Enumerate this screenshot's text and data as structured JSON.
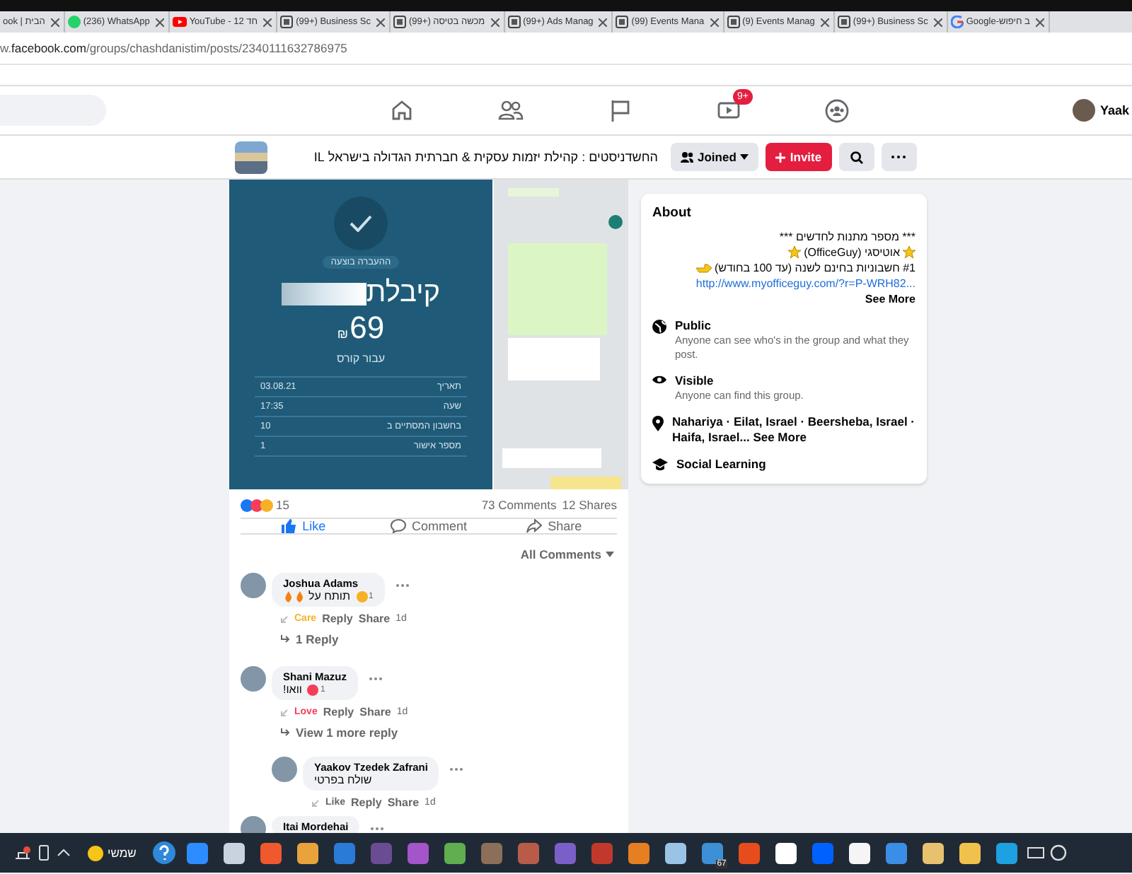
{
  "browser": {
    "tabs": [
      {
        "kind": "none",
        "title": "ook | הבית"
      },
      {
        "kind": "whatsapp",
        "title": "(236) WhatsApp"
      },
      {
        "kind": "youtube",
        "title": "YouTube - 12 חד"
      },
      {
        "kind": "facebook",
        "title": "(99+) Business Sc"
      },
      {
        "kind": "facebook",
        "title": "(99+) מכשה בטיסה"
      },
      {
        "kind": "facebook",
        "title": "(99+) Ads Manag"
      },
      {
        "kind": "facebook",
        "title": "(99) Events Mana"
      },
      {
        "kind": "facebook",
        "title": "(9) Events Manag"
      },
      {
        "kind": "facebook",
        "title": "(99+) Business Sc"
      },
      {
        "kind": "google",
        "title": "Google-ב חיפוש"
      }
    ],
    "url": {
      "prefix": "w.",
      "domain": "facebook.com",
      "path": "/groups/chashdanistim/posts/2340111632786975"
    }
  },
  "topbar": {
    "nav": [
      {
        "kind": "home"
      },
      {
        "kind": "friends"
      },
      {
        "kind": "pages"
      },
      {
        "kind": "watch",
        "badge": "9+"
      },
      {
        "kind": "groups"
      }
    ],
    "profile": "Yaak"
  },
  "group": {
    "title": "החשדניסטים : קהילת יזמות עסקית & חברתית הגדולה בישראל IL",
    "joined": "Joined",
    "invite": "Invite"
  },
  "post": {
    "receipt": {
      "status": "ההעברה בוצעה",
      "heading": "קיבלת",
      "amount": "69",
      "currency": "₪",
      "purpose": "עבור קורס",
      "rows": [
        {
          "label": "תאריך",
          "value": "03.08.21"
        },
        {
          "label": "שעה",
          "value": "17:35"
        },
        {
          "label": "בחשבון המסתיים ב",
          "value": "10"
        },
        {
          "label": "מספר אישור",
          "value": "1"
        }
      ]
    },
    "reactions": "15",
    "comments": "73 Comments",
    "shares": "12 Shares",
    "actions": [
      {
        "kind": "like",
        "label": "Like",
        "color": "#1877f2"
      },
      {
        "kind": "comment",
        "label": "Comment",
        "color": "#65676b"
      },
      {
        "kind": "share",
        "label": "Share",
        "color": "#65676b"
      }
    ],
    "sort": "All Comments",
    "thread": [
      {
        "author": "Joshua Adams",
        "text": "תותח על",
        "kind": "fire",
        "reaction_count": "1",
        "action": {
          "label": "Care",
          "color": "#f7b125"
        },
        "links": [
          "Reply",
          "Share"
        ],
        "time": "1d",
        "more": "1 Reply"
      },
      {
        "author": "Shani Mazuz",
        "text": "וואו!",
        "kind": "plain",
        "reaction_count": "1",
        "action": {
          "label": "Love",
          "color": "#f33e58"
        },
        "links": [
          "Reply",
          "Share"
        ],
        "time": "1d",
        "more": "View 1 more reply",
        "children": [
          {
            "author": "Yaakov Tzedek Zafrani",
            "text": "שולח בפרטי",
            "kind": "plain",
            "action": {
              "label": "Like",
              "color": "#65676b"
            },
            "links": [
              "Reply",
              "Share"
            ],
            "time": "1d"
          }
        ]
      },
      {
        "author": "Itai Mordehai"
      }
    ]
  },
  "about": {
    "title": "About",
    "description": [
      {
        "kind": "plain",
        "text": "*** מספר מתנות לחדשים ***"
      },
      {
        "kind": "starred",
        "text": "אוטיסגי (OfficeGuy)"
      },
      {
        "kind": "pointer",
        "text": "#1 חשבוניות בחינם לשנה (עד 100 בחודש)"
      }
    ],
    "link": "http://www.myofficeguy.com/?r=P-WRH82...",
    "see_more": "See More",
    "items": [
      {
        "kind": "globe",
        "title": "Public",
        "text": "Anyone can see who's in the group and what they post."
      },
      {
        "kind": "eye",
        "title": "Visible",
        "text": "Anyone can find this group."
      },
      {
        "kind": "pin",
        "title": "Nahariya · Eilat, Israel · Beersheba, Israel · Haifa, Israel...",
        "link": "See More"
      },
      {
        "kind": "cap",
        "title": "Social Learning"
      }
    ]
  },
  "taskbar": {
    "weather": "שמשי",
    "apps": [
      {
        "color": "#2d8cff"
      },
      {
        "color": "#c9d3e0"
      },
      {
        "color": "#f0582e"
      },
      {
        "color": "#e8a33d"
      },
      {
        "color": "#2a7bd8"
      },
      {
        "color": "#6a4c93"
      },
      {
        "color": "#a355c9"
      },
      {
        "color": "#5fae4f"
      },
      {
        "color": "#8b6f5a"
      },
      {
        "color": "#b85c4a"
      },
      {
        "color": "#7a5fc9"
      },
      {
        "color": "#c0392b"
      },
      {
        "color": "#e67e22"
      },
      {
        "color": "#9bc3e6"
      },
      {
        "color": "#3d8fd6",
        "badge": "67"
      },
      {
        "color": "#e74c1c"
      },
      {
        "color": "#ffffff"
      },
      {
        "color": "#0061fe"
      },
      {
        "color": "#f5f5f5"
      },
      {
        "color": "#3a8ee6"
      },
      {
        "color": "#e8c170"
      },
      {
        "color": "#f0c24b"
      },
      {
        "color": "#1da1e0"
      }
    ]
  }
}
